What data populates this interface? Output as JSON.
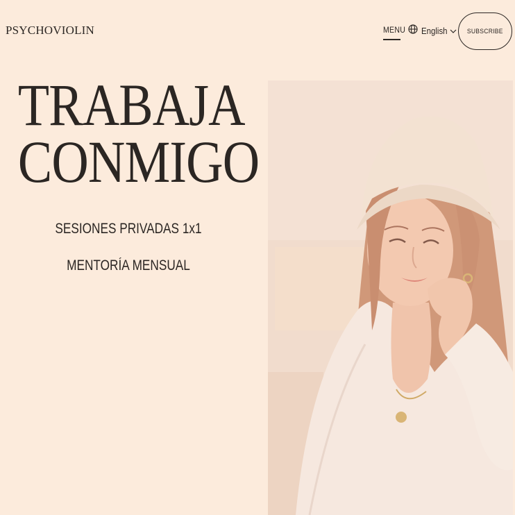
{
  "header": {
    "logo": "PSYCHOVIOLIN",
    "menu_label": "MENU",
    "language": "English",
    "subscribe_label": "SUBSCRIBE"
  },
  "hero": {
    "title_line1": "TRABAJA",
    "title_line2": "CONMIGO",
    "services": [
      "SESIONES PRIVADAS 1x1",
      "MENTORÍA MENSUAL"
    ]
  },
  "icons": {
    "language": "globe-icon",
    "language_dropdown": "chevron-down-icon"
  },
  "colors": {
    "background": "#fcebdc",
    "text": "#2b2623",
    "photo_tint": "#f3d6c3"
  }
}
